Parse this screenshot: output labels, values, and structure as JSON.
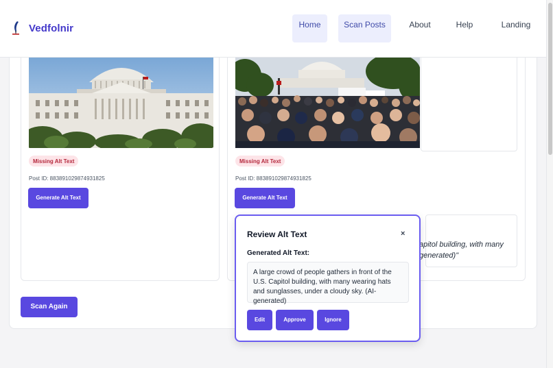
{
  "header": {
    "brand_name": "Vedfolnir",
    "nav": [
      {
        "label": "Home"
      },
      {
        "label": "Scan Posts"
      },
      {
        "label": "About"
      },
      {
        "label": "Help"
      },
      {
        "label": "Landing"
      }
    ]
  },
  "posts": [
    {
      "badge": "Missing Alt Text",
      "post_id": "Post ID: 883891029874931825",
      "button": "Generate Alt Text"
    },
    {
      "badge": "Missing Alt Text",
      "post_id": "Post ID: 883891029874931825",
      "button": "Generate Alt Text"
    }
  ],
  "alt_preview": {
    "line1": "apitol building, with many",
    "line2": "generated)\""
  },
  "scan_again": "Scan Again",
  "modal": {
    "title": "Review Alt Text",
    "close": "×",
    "label": "Generated Alt Text:",
    "text": "A large crowd of people gathers in front of the U.S. Capitol building, with many wearing hats and sunglasses, under a cloudy sky. (AI-generated)",
    "buttons": {
      "edit": "Edit",
      "approve": "Approve",
      "ignore": "Ignore"
    }
  },
  "colors": {
    "accent": "#5948e0",
    "brand": "#4338ca",
    "badge_bg": "#fde4e8",
    "badge_fg": "#b4283c",
    "modal_border": "#6a5cf0"
  }
}
